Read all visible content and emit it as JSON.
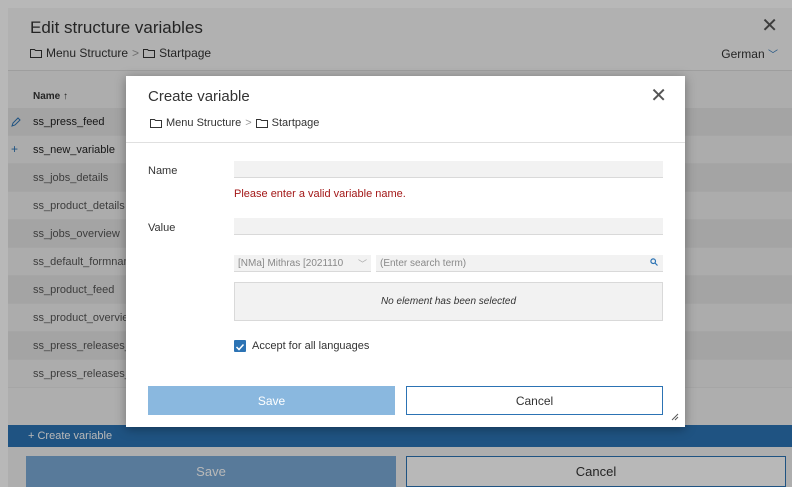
{
  "background": {
    "title": "Edit structure variables",
    "breadcrumb": [
      "Menu Structure",
      "Startpage"
    ],
    "breadcrumb_separator": ">",
    "language": "German",
    "column_header": "Name ↑",
    "rows": [
      {
        "name": "ss_press_feed",
        "lead": "pencil-icon",
        "bold": true
      },
      {
        "name": "ss_new_variable",
        "lead": "+",
        "bold": true
      },
      {
        "name": "ss_jobs_details"
      },
      {
        "name": "ss_product_details"
      },
      {
        "name": "ss_jobs_overview"
      },
      {
        "name": "ss_default_formnam"
      },
      {
        "name": "ss_product_feed"
      },
      {
        "name": "ss_product_overvie"
      },
      {
        "name": "ss_press_releases_"
      },
      {
        "name": "ss_press_releases_"
      }
    ],
    "create_label": "+ Create variable",
    "save_label": "Save",
    "cancel_label": "Cancel"
  },
  "modal": {
    "title": "Create variable",
    "breadcrumb": [
      "Menu Structure",
      "Startpage"
    ],
    "breadcrumb_separator": ">",
    "name_label": "Name",
    "name_value": "",
    "error_text": "Please enter a valid variable name.",
    "value_label": "Value",
    "value_value": "",
    "selector_value": "[NMa] Mithras [2021110",
    "search_placeholder": "(Enter search term)",
    "no_element_text": "No element has been selected",
    "accept_all_label": "Accept for all languages",
    "accept_all_checked": true,
    "save_label": "Save",
    "cancel_label": "Cancel"
  },
  "colors": {
    "accent": "#2c73b4",
    "error": "#a31818",
    "save_disabled": "#8ab8df"
  }
}
